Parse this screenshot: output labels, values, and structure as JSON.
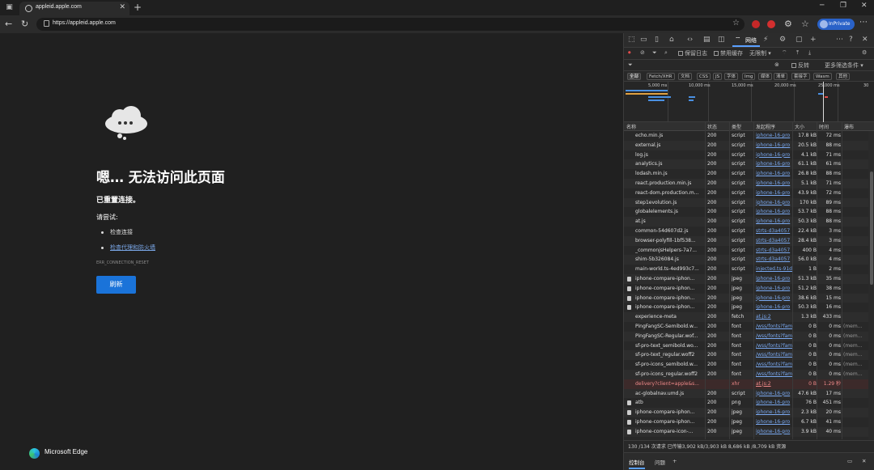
{
  "browser": {
    "tab_title": "appleid.apple.com",
    "url": "https://appleid.apple.com",
    "inprivate_label": "InPrivate"
  },
  "error_page": {
    "title": "嗯… 无法访问此页面",
    "subtitle": "已重置连接。",
    "try_label": "请尝试:",
    "suggestions": [
      "检查连接",
      "检查代理和防火墙"
    ],
    "error_code": "ERR_CONNECTION_RESET",
    "refresh_button": "刷新",
    "brand": "Microsoft Edge"
  },
  "devtools": {
    "network_tab": "网络",
    "toolbar": {
      "preserve_log": "保留日志",
      "disable_cache": "禁用缓存",
      "throttle": "无限制"
    },
    "filter": {
      "placeholder": "",
      "invert": "反转",
      "more_filters": "更多筛选条件"
    },
    "types": [
      "全部",
      "Fetch/XHR",
      "文档",
      "CSS",
      "JS",
      "字体",
      "Img",
      "媒体",
      "清单",
      "套接字",
      "Wasm",
      "其他"
    ],
    "overview_ticks": [
      "5,000 ms",
      "10,000 ms",
      "15,000 ms",
      "20,000 ms",
      "25,000 ms",
      "30"
    ],
    "columns": [
      "名称",
      "状态",
      "类型",
      "发起程序",
      "大小",
      "时间",
      "瀑布"
    ],
    "rows": [
      {
        "name": "echo.min.js",
        "status": "200",
        "type": "script",
        "initiator": "iphone-16-pro",
        "size": "17.8 kB",
        "time": "72 ms",
        "wf": ""
      },
      {
        "name": "external.js",
        "status": "200",
        "type": "script",
        "initiator": "iphone-16-pro",
        "size": "20.5 kB",
        "time": "88 ms",
        "wf": ""
      },
      {
        "name": "log.js",
        "status": "200",
        "type": "script",
        "initiator": "iphone-16-pro",
        "size": "4.1 kB",
        "time": "71 ms",
        "wf": ""
      },
      {
        "name": "analytics.js",
        "status": "200",
        "type": "script",
        "initiator": "iphone-16-pro",
        "size": "61.1 kB",
        "time": "61 ms",
        "wf": ""
      },
      {
        "name": "lodash.min.js",
        "status": "200",
        "type": "script",
        "initiator": "iphone-16-pro",
        "size": "26.8 kB",
        "time": "88 ms",
        "wf": ""
      },
      {
        "name": "react.production.min.js",
        "status": "200",
        "type": "script",
        "initiator": "iphone-16-pro",
        "size": "5.1 kB",
        "time": "71 ms",
        "wf": ""
      },
      {
        "name": "react-dom.production.m...",
        "status": "200",
        "type": "script",
        "initiator": "iphone-16-pro",
        "size": "43.9 kB",
        "time": "72 ms",
        "wf": ""
      },
      {
        "name": "step1evolution.js",
        "status": "200",
        "type": "script",
        "initiator": "iphone-16-pro",
        "size": "170 kB",
        "time": "89 ms",
        "wf": ""
      },
      {
        "name": "globalelements.js",
        "status": "200",
        "type": "script",
        "initiator": "iphone-16-pro",
        "size": "53.7 kB",
        "time": "88 ms",
        "wf": ""
      },
      {
        "name": "at.js",
        "status": "200",
        "type": "script",
        "initiator": "iphone-16-pro",
        "size": "50.3 kB",
        "time": "88 ms",
        "wf": ""
      },
      {
        "name": "common-54d607d2.js",
        "status": "200",
        "type": "script",
        "initiator": "strts-d3a4057",
        "size": "22.4 kB",
        "time": "3 ms",
        "wf": ""
      },
      {
        "name": "browser-polyfill-1bf538...",
        "status": "200",
        "type": "script",
        "initiator": "strts-d3a4057",
        "size": "28.4 kB",
        "time": "3 ms",
        "wf": ""
      },
      {
        "name": "_commonjsHelpers-7a7...",
        "status": "200",
        "type": "script",
        "initiator": "strts-d3a4057",
        "size": "400 B",
        "time": "4 ms",
        "wf": ""
      },
      {
        "name": "shim-5b326084.js",
        "status": "200",
        "type": "script",
        "initiator": "strts-d3a4057",
        "size": "56.0 kB",
        "time": "4 ms",
        "wf": ""
      },
      {
        "name": "main-world.ts-4ed993c7...",
        "status": "200",
        "type": "script",
        "initiator": "injected.ts-91d",
        "size": "1 B",
        "time": "2 ms",
        "wf": ""
      },
      {
        "name": "iphone-compare-iphon...",
        "status": "200",
        "type": "jpeg",
        "initiator": "iphone-16-pro",
        "size": "51.3 kB",
        "time": "35 ms",
        "wf": ""
      },
      {
        "name": "iphone-compare-iphon...",
        "status": "200",
        "type": "jpeg",
        "initiator": "iphone-16-pro",
        "size": "51.2 kB",
        "time": "38 ms",
        "wf": ""
      },
      {
        "name": "iphone-compare-iphon...",
        "status": "200",
        "type": "jpeg",
        "initiator": "iphone-16-pro",
        "size": "38.6 kB",
        "time": "15 ms",
        "wf": ""
      },
      {
        "name": "iphone-compare-iphon...",
        "status": "200",
        "type": "jpeg",
        "initiator": "iphone-16-pro",
        "size": "50.3 kB",
        "time": "16 ms",
        "wf": ""
      },
      {
        "name": "experience-meta",
        "status": "200",
        "type": "fetch",
        "initiator": "at.js:2",
        "size": "1.3 kB",
        "time": "433 ms",
        "wf": ""
      },
      {
        "name": "PingFangSC-Semibold.w...",
        "status": "200",
        "type": "font",
        "initiator": "/wss/fonts?fam",
        "size": "0 B",
        "time": "0 ms",
        "wf": "(mem..."
      },
      {
        "name": "PingFangSC-Regular.wof...",
        "status": "200",
        "type": "font",
        "initiator": "/wss/fonts?fam",
        "size": "0 B",
        "time": "0 ms",
        "wf": "(mem..."
      },
      {
        "name": "sf-pro-text_semibold.wo...",
        "status": "200",
        "type": "font",
        "initiator": "/wss/fonts?fam",
        "size": "0 B",
        "time": "0 ms",
        "wf": "(mem..."
      },
      {
        "name": "sf-pro-text_regular.woff2",
        "status": "200",
        "type": "font",
        "initiator": "/wss/fonts?fam",
        "size": "0 B",
        "time": "0 ms",
        "wf": "(mem..."
      },
      {
        "name": "sf-pro-icons_semibold.w...",
        "status": "200",
        "type": "font",
        "initiator": "/wss/fonts?fam",
        "size": "0 B",
        "time": "0 ms",
        "wf": "(mem..."
      },
      {
        "name": "sf-pro-icons_regular.woff2",
        "status": "200",
        "type": "font",
        "initiator": "/wss/fonts?fam",
        "size": "0 B",
        "time": "0 ms",
        "wf": "(mem..."
      },
      {
        "name": "delivery?client=apple&s...",
        "status": "",
        "type": "xhr",
        "initiator": "at.js:2",
        "size": "0 B",
        "time": "1.29 秒",
        "wf": "",
        "error": true
      },
      {
        "name": "ac-globalnav.umd.js",
        "status": "200",
        "type": "script",
        "initiator": "iphone-16-pro",
        "size": "47.6 kB",
        "time": "17 ms",
        "wf": ""
      },
      {
        "name": "atb",
        "status": "200",
        "type": "png",
        "initiator": "iphone-16-pro",
        "size": "76 B",
        "time": "451 ms",
        "wf": ""
      },
      {
        "name": "iphone-compare-iphon...",
        "status": "200",
        "type": "jpeg",
        "initiator": "iphone-16-pro",
        "size": "2.3 kB",
        "time": "20 ms",
        "wf": ""
      },
      {
        "name": "iphone-compare-iphon...",
        "status": "200",
        "type": "jpeg",
        "initiator": "iphone-16-pro",
        "size": "6.7 kB",
        "time": "41 ms",
        "wf": ""
      },
      {
        "name": "iphone-compare-icon-...",
        "status": "200",
        "type": "jpeg",
        "initiator": "iphone-16-pro",
        "size": "3.9 kB",
        "time": "40 ms",
        "wf": ""
      }
    ],
    "status_bar": "130 /134 次请求   已传输3,902 kB/3,903 kB   8,686 kB /8,709 kB 资源",
    "drawer_tabs": [
      "控制台",
      "问题"
    ]
  }
}
